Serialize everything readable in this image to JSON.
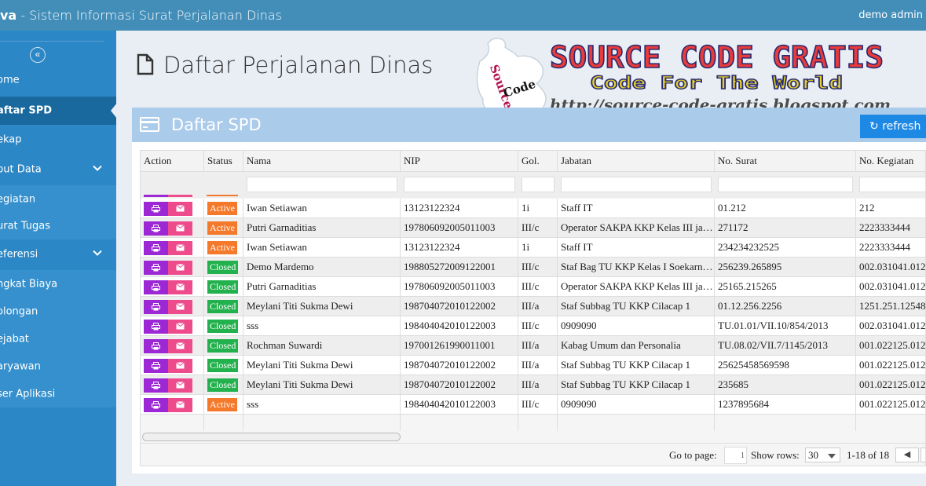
{
  "app": {
    "brand_bold": "va",
    "brand_rest": " - Sistem Informasi Surat Perjalanan Dinas",
    "user": "demo admin"
  },
  "sidebar": {
    "collapse_icon": "double-chevron-left-icon",
    "items": [
      {
        "label": "ome"
      },
      {
        "label": "aftar SPD"
      },
      {
        "label": "ekap"
      },
      {
        "label": "put Data"
      },
      {
        "label": "egiatan"
      },
      {
        "label": "urat Tugas"
      },
      {
        "label": "eferensi"
      },
      {
        "label": "ngkat Biaya"
      },
      {
        "label": "olongan"
      },
      {
        "label": "ejabat"
      },
      {
        "label": "aryawan"
      },
      {
        "label": "ser Aplikasi"
      }
    ]
  },
  "page": {
    "title": "Daftar Perjalanan Dinas"
  },
  "watermark": {
    "puzzle_text_1": "Source",
    "puzzle_text_2": "Code",
    "line1": "SOURCE CODE GRATIS",
    "line2": "Code For The World",
    "line3": "http://source-code-gratis.blogspot.com"
  },
  "panel": {
    "title": "Daftar SPD",
    "refresh_label": "refresh"
  },
  "table": {
    "headers": [
      "Action",
      "Status",
      "Nama",
      "NIP",
      "Gol.",
      "Jabatan",
      "No. Surat",
      "No. Kegiatan"
    ],
    "rows": [
      {
        "status": "Active",
        "nama": "Iwan Setiawan",
        "nip": "13123122324",
        "gol": "1i",
        "jabatan": "Staff IT",
        "surat": "01.212",
        "kegiatan": "212"
      },
      {
        "status": "Active",
        "nama": "Putri Garnaditias",
        "nip": "197806092005011003",
        "gol": "III/c",
        "jabatan": "Operator SAKPA KKP Kelas III jakarta",
        "surat": "271172",
        "kegiatan": "2223333444"
      },
      {
        "status": "Active",
        "nama": "Iwan Setiawan",
        "nip": "13123122324",
        "gol": "1i",
        "jabatan": "Staff IT",
        "surat": "234234232525",
        "kegiatan": "2223333444"
      },
      {
        "status": "Closed",
        "nama": "Demo Mardemo",
        "nip": "198805272009122001",
        "gol": "III/c",
        "jabatan": "Staf Bag TU KKP Kelas I Soekarno-Hatta",
        "surat": "256239.265895",
        "kegiatan": "002.031041.012"
      },
      {
        "status": "Closed",
        "nama": "Putri Garnaditias",
        "nip": "197806092005011003",
        "gol": "III/c",
        "jabatan": "Operator SAKPA KKP Kelas III jakarta",
        "surat": "25165.215265",
        "kegiatan": "002.031041.012"
      },
      {
        "status": "Closed",
        "nama": "Meylani Titi Sukma Dewi",
        "nip": "198704072010122002",
        "gol": "III/a",
        "jabatan": "Staf Subbag TU KKP Cilacap 1",
        "surat": "01.12.256.2256",
        "kegiatan": "1251.251.12548"
      },
      {
        "status": "Closed",
        "nama": "sss",
        "nip": "198404042010122003",
        "gol": "III/c",
        "jabatan": "0909090",
        "surat": "TU.01.01/VII.10/854/2013",
        "kegiatan": "002.031041.012"
      },
      {
        "status": "Closed",
        "nama": "Rochman Suwardi",
        "nip": "197001261990011001",
        "gol": "III/a",
        "jabatan": "Kabag Umum dan Personalia",
        "surat": "TU.08.02/VII.7/1145/2013",
        "kegiatan": "001.022125.012"
      },
      {
        "status": "Closed",
        "nama": "Meylani Titi Sukma Dewi",
        "nip": "198704072010122002",
        "gol": "III/a",
        "jabatan": "Staf Subbag TU KKP Cilacap 1",
        "surat": "25625458569598",
        "kegiatan": "001.022125.012"
      },
      {
        "status": "Closed",
        "nama": "Meylani Titi Sukma Dewi",
        "nip": "198704072010122002",
        "gol": "III/a",
        "jabatan": "Staf Subbag TU KKP Cilacap 1",
        "surat": "235685",
        "kegiatan": "001.022125.012"
      },
      {
        "status": "Active",
        "nama": "sss",
        "nip": "198404042010122003",
        "gol": "III/c",
        "jabatan": "0909090",
        "surat": "1237895684",
        "kegiatan": "001.022125.012"
      }
    ]
  },
  "pager": {
    "goto_label": "Go to page:",
    "goto_value": "1",
    "rows_label": "Show rows:",
    "rows_value": "30",
    "range": "1-18 of 18"
  },
  "colors": {
    "topbar": "#438eb9",
    "sidebar": "#2b87c6",
    "active_badge": "#f4792b",
    "closed_badge": "#23b14d",
    "print_button": "#9c27d4",
    "mail_button": "#ee4b8c"
  }
}
